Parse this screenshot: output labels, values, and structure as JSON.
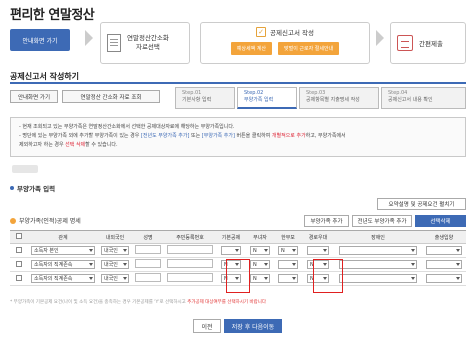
{
  "page": {
    "title": "편리한 연말정산"
  },
  "steps": {
    "guide_btn": "안내화면 가기",
    "doc": [
      "연말정산간소화",
      "자료선택"
    ],
    "main_title": "공제신고서 작성",
    "chips": [
      "예상세액 계산",
      "맞벌이 근로자 절세안내"
    ],
    "submit": "간편제출"
  },
  "section": {
    "title": "공제신고서 작성하기"
  },
  "buttons": {
    "guide": "안내화면 가기",
    "simple": "연말정산 간소화 자료 조회"
  },
  "tabs": [
    {
      "step": "Step.01",
      "label": "기본사항 입력"
    },
    {
      "step": "Step.02",
      "label": "부양가족 입력"
    },
    {
      "step": "Step.03",
      "label": "공제항목별 지출명세 작성"
    },
    {
      "step": "Step.04",
      "label": "공제신고서 내용 확인"
    }
  ],
  "notice": {
    "l1": "- 현재 조회되고 있는 부양가족은 연말정산간소화에서 선택한 공제대상자료에 해당하는 부양가족입니다.",
    "l2a": "- 명단에 있는 부양가족 외에 추가할 부양가족이 있는 경우 ",
    "l2b": "[전년도 부양가족 추가]",
    "l2c": " 또는 ",
    "l2d": "[부양가족 추가]",
    "l2e": " 버튼을 클릭하여 ",
    "l2f": "개별적으로 추가",
    "l2g": "하고, 부양가족에서",
    "l3a": "  제외하고자 하는 경우 ",
    "l3b": "선택 삭제",
    "l3c": "할 수 있습니다."
  },
  "sub": {
    "title": "부양가족 입력",
    "table_label": "부양가족(인적)공제 명세"
  },
  "actions": {
    "guide": "요약설명 및 공제요건 펼치기",
    "add": "부양가족 추가",
    "add_prev": "전년도 부양가족 추가",
    "delete": "선택삭제"
  },
  "table": {
    "headers": [
      "",
      "관계",
      "내외국인",
      "성명",
      "주민등록번호",
      "기본공제",
      "부녀자",
      "한부모",
      "경로우대",
      "장애인",
      "출생입양"
    ],
    "rows": [
      {
        "relation": "소득자 본인",
        "nation": "내국인",
        "basic": "",
        "woman": "N",
        "single": "N",
        "elder": "",
        "disabled": "",
        "birth": ""
      },
      {
        "relation": "소득자의 직계존속",
        "nation": "내국인",
        "basic": "N",
        "woman": "N",
        "single": "",
        "elder": "N",
        "disabled": "",
        "birth": ""
      },
      {
        "relation": "소득자의 직계존속",
        "nation": "내국인",
        "basic": "N",
        "woman": "N",
        "single": "",
        "elder": "N",
        "disabled": "",
        "birth": ""
      }
    ]
  },
  "footnote": {
    "a": "* 부양가족이 기본공제 요건(나이 및 소득 요건)을 충족하는 경우 기본공제를 'Y'로 선택하시고 ",
    "b": "추가공제 대상여부를 선택하시기 바랍니다"
  },
  "nav": {
    "prev": "이전",
    "next": "저장 후 다음이동"
  },
  "colors": {
    "accent": "#3d6ab5",
    "orange": "#f3a43b",
    "highlight": "#e02020"
  }
}
